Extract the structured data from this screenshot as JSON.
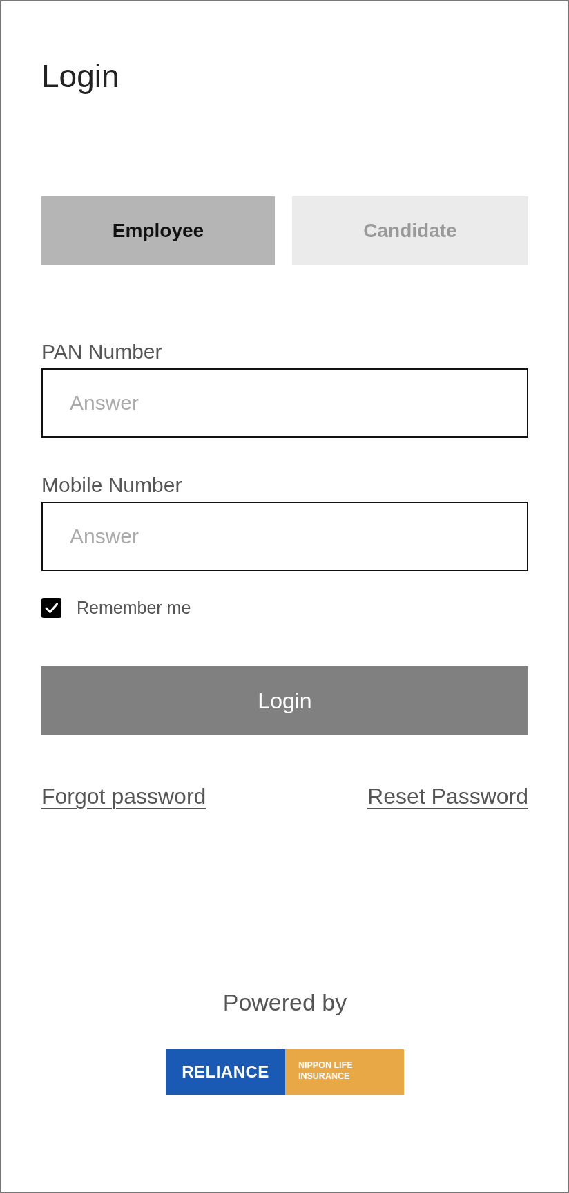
{
  "title": "Login",
  "tabs": [
    {
      "label": "Employee",
      "selected": true
    },
    {
      "label": "Candidate",
      "selected": false
    }
  ],
  "fields": [
    {
      "label": "PAN Number",
      "placeholder": "Answer"
    },
    {
      "label": "Mobile Number",
      "placeholder": "Answer"
    }
  ],
  "remember": {
    "label": "Remember me",
    "checked": true
  },
  "login_button": "Login",
  "links": [
    "Forgot password",
    "Reset Password"
  ],
  "footer": {
    "powered_by": "Powered by",
    "logo": {
      "wordmark": "RELIANCE",
      "tagline": [
        "NIPPON LIFE",
        "INSURANCE"
      ]
    }
  }
}
